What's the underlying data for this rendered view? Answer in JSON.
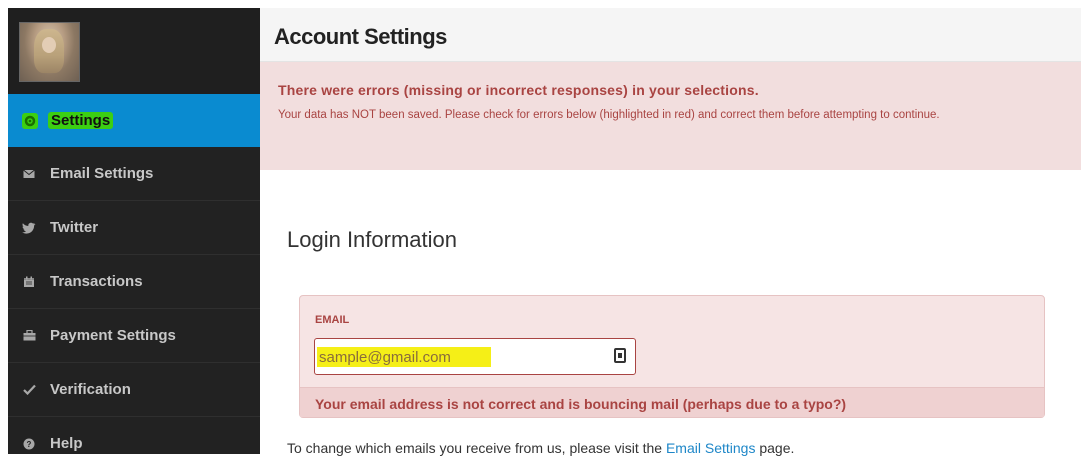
{
  "sidebar": {
    "items": [
      {
        "label": "Settings",
        "icon": "gear-icon",
        "active": true
      },
      {
        "label": "Email Settings",
        "icon": "envelope-icon"
      },
      {
        "label": "Twitter",
        "icon": "twitter-icon"
      },
      {
        "label": "Transactions",
        "icon": "calendar-icon"
      },
      {
        "label": "Payment Settings",
        "icon": "briefcase-icon"
      },
      {
        "label": "Verification",
        "icon": "checkmark-icon"
      },
      {
        "label": "Help",
        "icon": "help-icon"
      }
    ]
  },
  "header": {
    "title": "Account Settings"
  },
  "alert": {
    "title": "There were errors (missing or incorrect responses) in your selections.",
    "message": "Your data has NOT been saved. Please check for errors below (highlighted in red) and correct them before attempting to continue."
  },
  "section": {
    "title": "Login Information"
  },
  "email_field": {
    "label": "EMAIL",
    "value": "sample@gmail.com",
    "error": "Your email address is not correct and is bouncing mail (perhaps due to a typo?)"
  },
  "footer": {
    "text_before": "To change which emails you receive from us, please visit the ",
    "link": "Email Settings",
    "text_after": " page."
  },
  "colors": {
    "active_nav": "#0a8bd0",
    "highlight_green": "#3ccf12",
    "highlight_yellow": "#f5ef17",
    "error_text": "#a94442"
  }
}
